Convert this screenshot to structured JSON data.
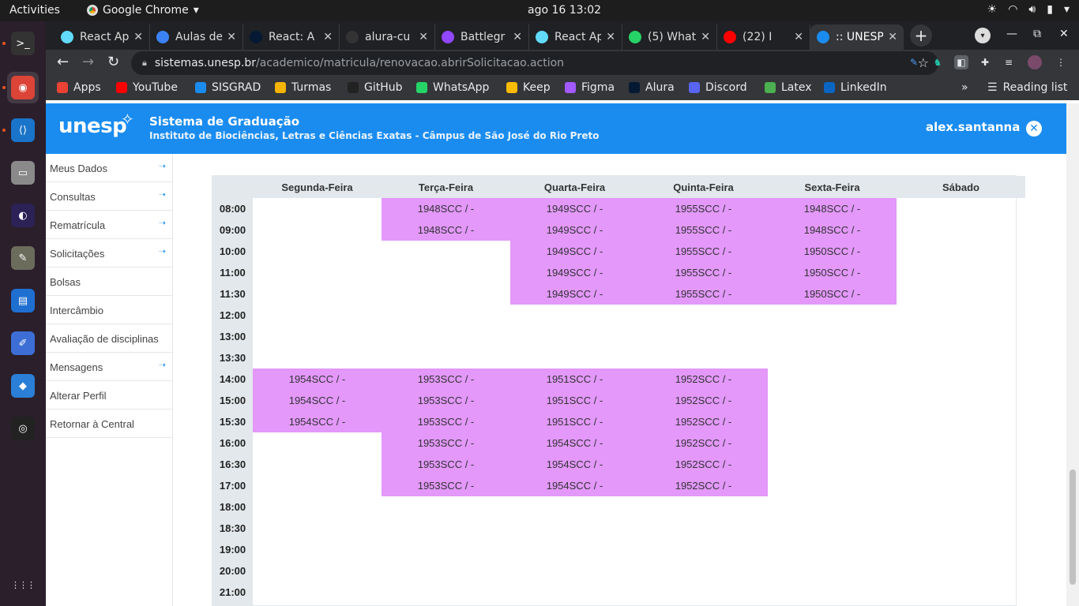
{
  "desktop": {
    "activities": "Activities",
    "app_name": "Google Chrome",
    "clock": "ago 16  13:02"
  },
  "dock": {
    "items": [
      {
        "name": "terminal-icon",
        "glyph": ">_",
        "color": "#333333",
        "active": false
      },
      {
        "name": "chrome-icon",
        "glyph": "◉",
        "color": "#db4437",
        "active": true
      },
      {
        "name": "vscode-icon",
        "glyph": "⟨⟩",
        "color": "#1a74c9",
        "active": false
      },
      {
        "name": "files-icon",
        "glyph": "▭",
        "color": "#8a8a8a",
        "active": false
      },
      {
        "name": "eclipse-icon",
        "glyph": "◐",
        "color": "#2c2255",
        "active": false
      },
      {
        "name": "gimp-icon",
        "glyph": "✎",
        "color": "#6c6c5c",
        "active": false
      },
      {
        "name": "libreoffice-writer-icon",
        "glyph": "▤",
        "color": "#1f6fd1",
        "active": false
      },
      {
        "name": "text-editor-icon",
        "glyph": "✐",
        "color": "#3c6ed6",
        "active": false
      },
      {
        "name": "virtualbox-icon",
        "glyph": "◆",
        "color": "#2b7fd6",
        "active": false
      },
      {
        "name": "obs-icon",
        "glyph": "◎",
        "color": "#222222",
        "active": false
      },
      {
        "name": "show-apps-icon",
        "glyph": "⋮⋮⋮",
        "color": "transparent",
        "active": false
      }
    ]
  },
  "tabs": [
    {
      "title": "React Ap",
      "icon_color": "#61dafb",
      "active": false
    },
    {
      "title": "Aulas de",
      "icon_color": "#3b82f6",
      "active": false
    },
    {
      "title": "React: A",
      "icon_color": "#051933",
      "active": false
    },
    {
      "title": "alura-cu",
      "icon_color": "#333333",
      "active": false
    },
    {
      "title": "Battlegr",
      "icon_color": "#9146ff",
      "active": false
    },
    {
      "title": "React Ap",
      "icon_color": "#61dafb",
      "active": false
    },
    {
      "title": "(5) What",
      "icon_color": "#25d366",
      "active": false
    },
    {
      "title": "(22) I",
      "icon_color": "#ff0000",
      "active": false
    },
    {
      "title": ":: UNESP",
      "icon_color": "#1a8cf0",
      "active": true
    }
  ],
  "toolbar": {
    "url_domain": "sistemas.unesp.br",
    "url_path": "/academico/matricula/renovacao.abrirSolicitacao.action"
  },
  "bookmarks": [
    {
      "label": "Apps",
      "color": "#ea4335"
    },
    {
      "label": "YouTube",
      "color": "#ff0000"
    },
    {
      "label": "SISGRAD",
      "color": "#1a8cf0"
    },
    {
      "label": "Turmas",
      "color": "#f4b400"
    },
    {
      "label": "GitHub",
      "color": "#222222"
    },
    {
      "label": "WhatsApp",
      "color": "#25d366"
    },
    {
      "label": "Keep",
      "color": "#fbbc04"
    },
    {
      "label": "Figma",
      "color": "#a259ff"
    },
    {
      "label": "Alura",
      "color": "#051933"
    },
    {
      "label": "Discord",
      "color": "#5865f2"
    },
    {
      "label": "Latex",
      "color": "#4caf50"
    },
    {
      "label": "LinkedIn",
      "color": "#0a66c2"
    }
  ],
  "bookmarks_more": "»",
  "reading_list": "Reading list",
  "header": {
    "logo": "unesp",
    "title": "Sistema de Graduação",
    "subtitle": "Instituto de Biociências, Letras e Ciências Exatas - Câmpus de São José do Rio Preto",
    "user": "alex.santanna"
  },
  "sidebar": [
    {
      "label": "Meus Dados",
      "arrow": true
    },
    {
      "label": "Consultas",
      "arrow": true
    },
    {
      "label": "Rematrícula",
      "arrow": true
    },
    {
      "label": "Solicitações",
      "arrow": true
    },
    {
      "label": "Bolsas",
      "arrow": false
    },
    {
      "label": "Intercâmbio",
      "arrow": false
    },
    {
      "label": "Avaliação de disciplinas",
      "arrow": false
    },
    {
      "label": "Mensagens",
      "arrow": true
    },
    {
      "label": "Alterar Perfil",
      "arrow": false
    },
    {
      "label": "Retornar à Central",
      "arrow": false
    }
  ],
  "schedule": {
    "days": [
      "Segunda-Feira",
      "Terça-Feira",
      "Quarta-Feira",
      "Quinta-Feira",
      "Sexta-Feira",
      "Sábado"
    ],
    "times": [
      "08:00",
      "09:00",
      "10:00",
      "11:00",
      "11:30",
      "12:00",
      "13:00",
      "13:30",
      "14:00",
      "15:00",
      "15:30",
      "16:00",
      "16:30",
      "17:00",
      "18:00",
      "18:30",
      "19:00",
      "20:00",
      "21:00"
    ],
    "rows": [
      [
        "",
        "1948SCC / -",
        "1949SCC / -",
        "1955SCC / -",
        "1948SCC / -",
        ""
      ],
      [
        "",
        "1948SCC / -",
        "1949SCC / -",
        "1955SCC / -",
        "1948SCC / -",
        ""
      ],
      [
        "",
        "",
        "1949SCC / -",
        "1955SCC / -",
        "1950SCC / -",
        ""
      ],
      [
        "",
        "",
        "1949SCC / -",
        "1955SCC / -",
        "1950SCC / -",
        ""
      ],
      [
        "",
        "",
        "1949SCC / -",
        "1955SCC / -",
        "1950SCC / -",
        ""
      ],
      [
        "",
        "",
        "",
        "",
        "",
        ""
      ],
      [
        "",
        "",
        "",
        "",
        "",
        ""
      ],
      [
        "",
        "",
        "",
        "",
        "",
        ""
      ],
      [
        "1954SCC / -",
        "1953SCC / -",
        "1951SCC / -",
        "1952SCC / -",
        "",
        ""
      ],
      [
        "1954SCC / -",
        "1953SCC / -",
        "1951SCC / -",
        "1952SCC / -",
        "",
        ""
      ],
      [
        "1954SCC / -",
        "1953SCC / -",
        "1951SCC / -",
        "1952SCC / -",
        "",
        ""
      ],
      [
        "",
        "1953SCC / -",
        "1954SCC / -",
        "1952SCC / -",
        "",
        ""
      ],
      [
        "",
        "1953SCC / -",
        "1954SCC / -",
        "1952SCC / -",
        "",
        ""
      ],
      [
        "",
        "1953SCC / -",
        "1954SCC / -",
        "1952SCC / -",
        "",
        ""
      ],
      [
        "",
        "",
        "",
        "",
        "",
        ""
      ],
      [
        "",
        "",
        "",
        "",
        "",
        ""
      ],
      [
        "",
        "",
        "",
        "",
        "",
        ""
      ],
      [
        "",
        "",
        "",
        "",
        "",
        ""
      ],
      [
        "",
        "",
        "",
        "",
        "",
        ""
      ]
    ],
    "highlight_color": "#e398fa"
  }
}
